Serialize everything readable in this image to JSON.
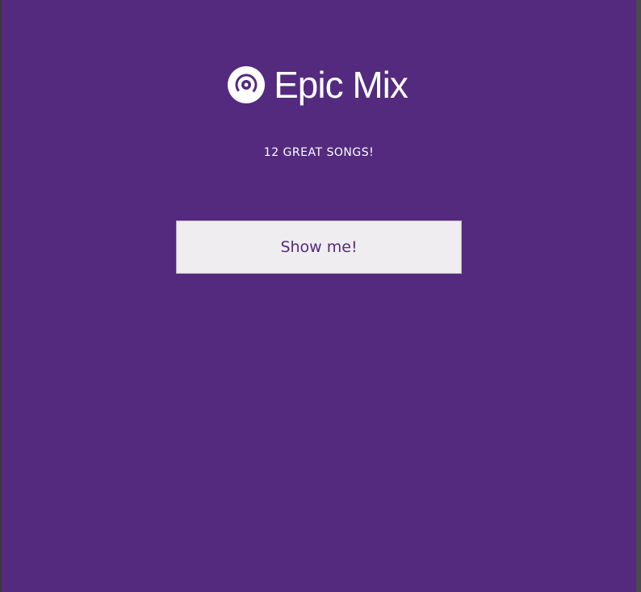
{
  "app": {
    "name": "Epic Mix",
    "logo_icon": "vinyl-record-icon",
    "subtitle": "12 GREAT SONGS!",
    "cta_label": "Show me!"
  },
  "colors": {
    "background": "#542a7e",
    "button_background": "#efedef",
    "button_text": "#542a7e",
    "text": "#ffffff"
  }
}
